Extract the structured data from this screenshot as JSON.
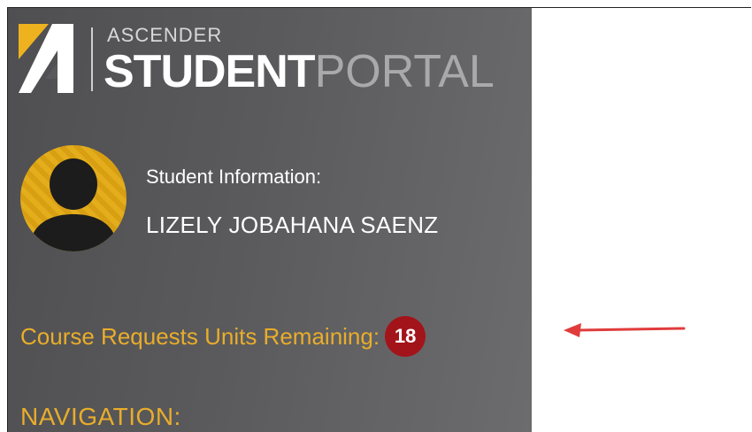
{
  "logo": {
    "brand_top": "ASCENDER",
    "brand_main": "STUDENT",
    "brand_suffix": "PORTAL"
  },
  "student": {
    "heading": "Student Information:",
    "name": "LIZELY JOBAHANA SAENZ"
  },
  "course_requests": {
    "label": "Course Requests Units Remaining:",
    "units_remaining": "18"
  },
  "navigation": {
    "heading": "NAVIGATION:"
  },
  "colors": {
    "sidebar_bg": "#5a5a5c",
    "accent_gold": "#e9ad2b",
    "badge_red": "#a3141a",
    "arrow_red": "#e03c3c"
  }
}
